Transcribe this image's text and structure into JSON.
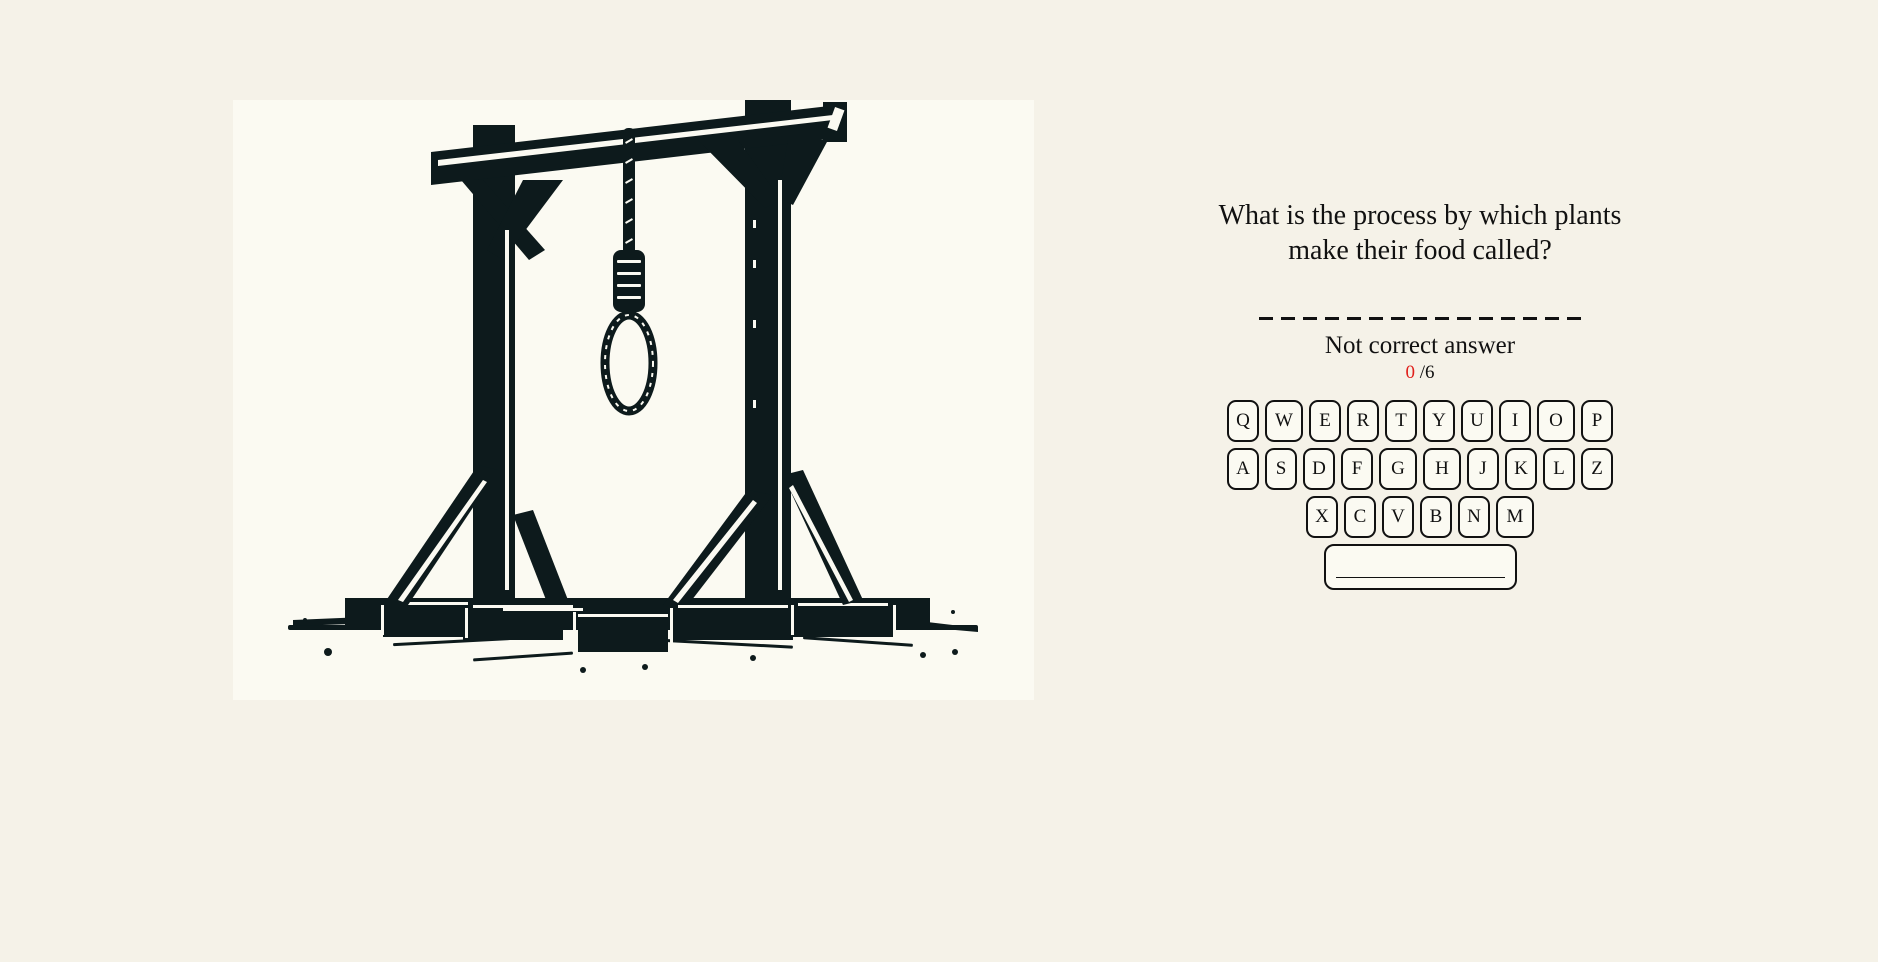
{
  "game": {
    "question": "What is the process by which plants make their food called?",
    "word_slots": [
      "",
      "",
      "",
      "",
      "",
      "",
      "",
      "",
      "",
      "",
      "",
      "",
      "",
      "",
      ""
    ],
    "status": "Not correct answer",
    "wrong_count": "0",
    "max_wrong": "/6",
    "wrong_color": "#e0201b"
  },
  "keyboard": {
    "rows": [
      [
        "Q",
        "W",
        "E",
        "R",
        "T",
        "Y",
        "U",
        "I",
        "O",
        "P"
      ],
      [
        "A",
        "S",
        "D",
        "F",
        "G",
        "H",
        "J",
        "K",
        "L",
        "Z"
      ],
      [
        "X",
        "C",
        "V",
        "B",
        "N",
        "M"
      ]
    ],
    "space_label": ""
  },
  "image": {
    "icon": "gallows-icon",
    "background": "#fbfaf2",
    "ink": "#0d1a1c"
  },
  "colors": {
    "page_background": "#f5f2e8"
  }
}
